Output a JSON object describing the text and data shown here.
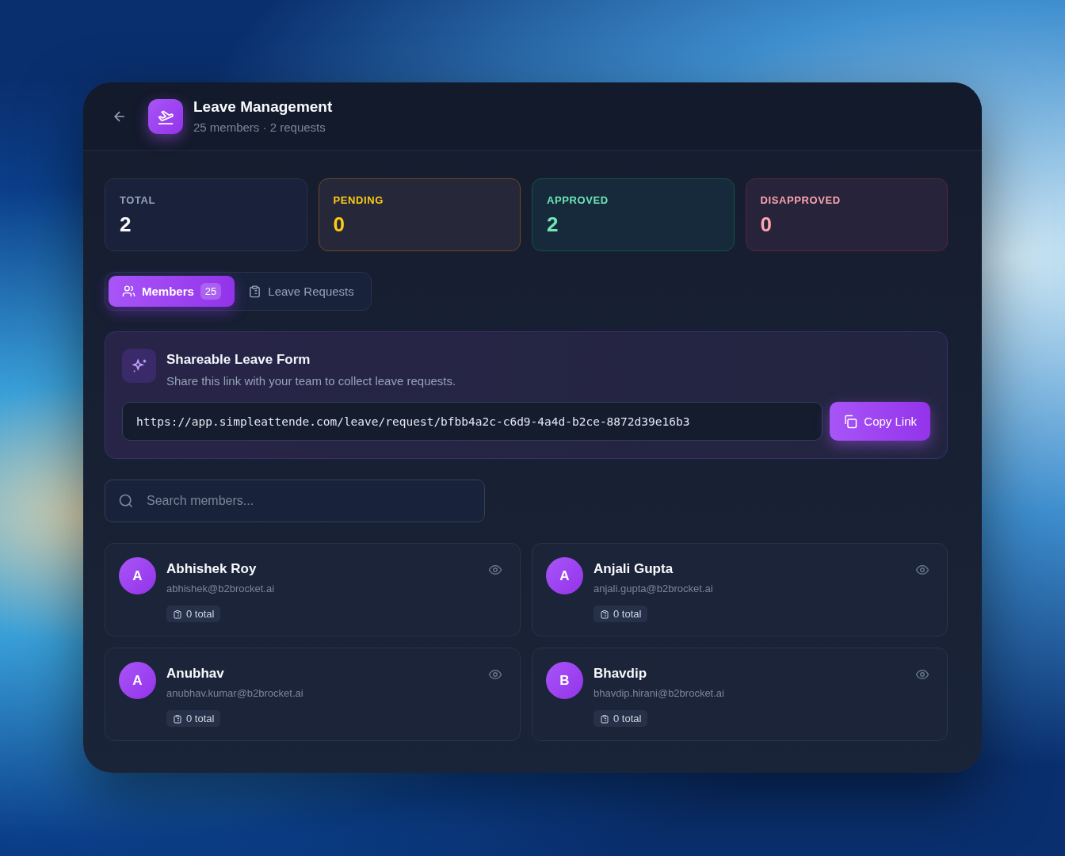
{
  "header": {
    "title": "Leave Management",
    "subtitle": "25 members · 2 requests"
  },
  "stats": [
    {
      "kind": "total",
      "label": "TOTAL",
      "value": "2"
    },
    {
      "kind": "pending",
      "label": "PENDING",
      "value": "0"
    },
    {
      "kind": "approved",
      "label": "APPROVED",
      "value": "2"
    },
    {
      "kind": "disapproved",
      "label": "DISAPPROVED",
      "value": "0"
    }
  ],
  "tabs": [
    {
      "kind": "members",
      "label": "Members",
      "count": "25",
      "selected": true
    },
    {
      "kind": "requests",
      "label": "Leave Requests",
      "selected": false
    }
  ],
  "share_form": {
    "title": "Shareable Leave Form",
    "description": "Share this link with your team to collect leave requests.",
    "link": "https://app.simpleattende.com/leave/request/bfbb4a2c-c6d9-4a4d-b2ce-8872d39e16b3",
    "button": "Copy Link"
  },
  "search": {
    "placeholder": "Search members..."
  },
  "members": [
    {
      "initial": "A",
      "name": "Abhishek Roy",
      "email": "abhishek@b2brocket.ai",
      "total": "0 total"
    },
    {
      "initial": "A",
      "name": "Anjali Gupta",
      "email": "anjali.gupta@b2brocket.ai",
      "total": "0 total"
    },
    {
      "initial": "A",
      "name": "Anubhav",
      "email": "anubhav.kumar@b2brocket.ai",
      "total": "0 total"
    },
    {
      "initial": "B",
      "name": "Bhavdip",
      "email": "bhavdip.hirani@b2brocket.ai",
      "total": "0 total"
    }
  ]
}
